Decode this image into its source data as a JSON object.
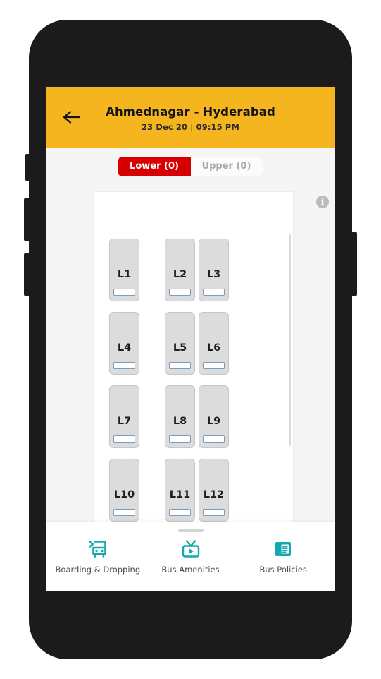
{
  "header": {
    "back_icon": "arrow-left-icon",
    "route": "Ahmednagar - Hyderabad",
    "datetime": "23 Dec 20 | 09:15 PM",
    "bg_color": "#f5b51f"
  },
  "deck_tabs": [
    {
      "label": "Lower (0)",
      "active": true,
      "bg_color": "#d60000",
      "text_color": "#ffffff"
    },
    {
      "label": "Upper (0)",
      "active": false,
      "bg_color": "#fbfbfb",
      "text_color": "#a8a8a8"
    }
  ],
  "seatmap": {
    "info_icon": "info-icon",
    "info_glyph": "i",
    "seat_fill_color": "#dcdcdc",
    "seat_bar_color": "#7a9cc2",
    "rows": [
      {
        "aisle_seat": "L1",
        "pair": [
          "L2",
          "L3"
        ]
      },
      {
        "aisle_seat": "L4",
        "pair": [
          "L5",
          "L6"
        ]
      },
      {
        "aisle_seat": "L7",
        "pair": [
          "L8",
          "L9"
        ]
      },
      {
        "aisle_seat": "L10",
        "pair": [
          "L11",
          "L12"
        ]
      }
    ]
  },
  "bottom_nav": {
    "items": [
      {
        "label": "Boarding & Dropping",
        "icon": "bus-icon"
      },
      {
        "label": "Bus Amenities",
        "icon": "tv-icon"
      },
      {
        "label": "Bus Policies",
        "icon": "document-icon"
      }
    ],
    "accent_color": "#16a8b0"
  }
}
